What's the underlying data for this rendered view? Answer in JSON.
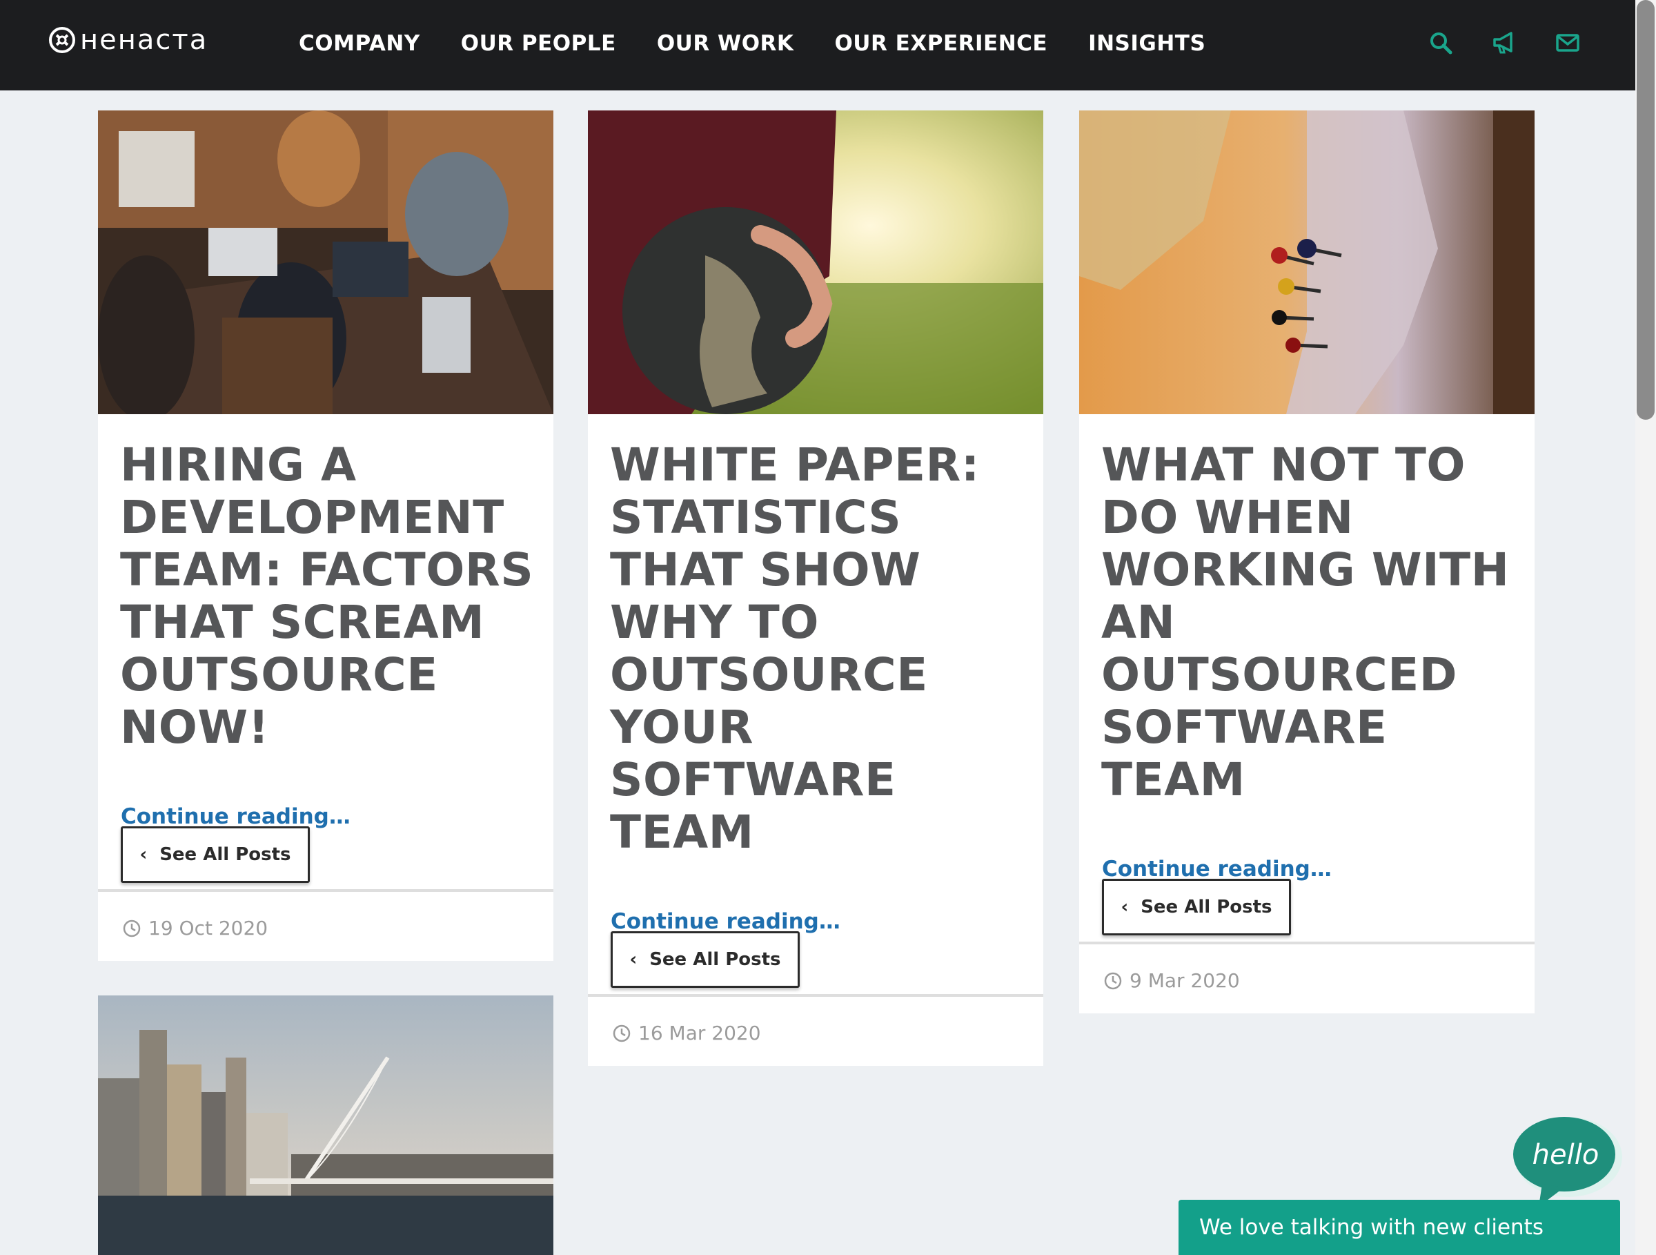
{
  "brand": {
    "name": "нeнacтa"
  },
  "nav": {
    "items": [
      {
        "label": "COMPANY"
      },
      {
        "label": "OUR PEOPLE"
      },
      {
        "label": "OUR WORK"
      },
      {
        "label": "OUR EXPERIENCE"
      },
      {
        "label": "INSIGHTS"
      }
    ]
  },
  "tools": {
    "icons": [
      "search-icon",
      "megaphone-icon",
      "mail-icon"
    ],
    "accent": "#1aa58c"
  },
  "posts": [
    {
      "title": "HIRING A DEVELOPMENT TEAM: FACTORS THAT SCREAM OUTSOURCE NOW!",
      "continue": "Continue reading…",
      "button": "See All Posts",
      "date": "19 Oct 2020"
    },
    {
      "title": "WHITE PAPER: STATISTICS THAT SHOW WHY TO OUTSOURCE YOUR SOFTWARE TEAM",
      "continue": "Continue reading…",
      "button": "See All Posts",
      "date": "16 Mar 2020"
    },
    {
      "title": "WHAT NOT TO DO WHEN WORKING WITH AN OUTSOURCED SOFTWARE TEAM",
      "continue": "Continue reading…",
      "button": "See All Posts",
      "date": "9 Mar 2020"
    }
  ],
  "chat": {
    "bubble": "hello",
    "bar": "We love talking with new clients"
  },
  "colors": {
    "nav_bg": "#1c1d1f",
    "link": "#1f6fae",
    "title": "#555658",
    "chat": "#13a08a"
  }
}
